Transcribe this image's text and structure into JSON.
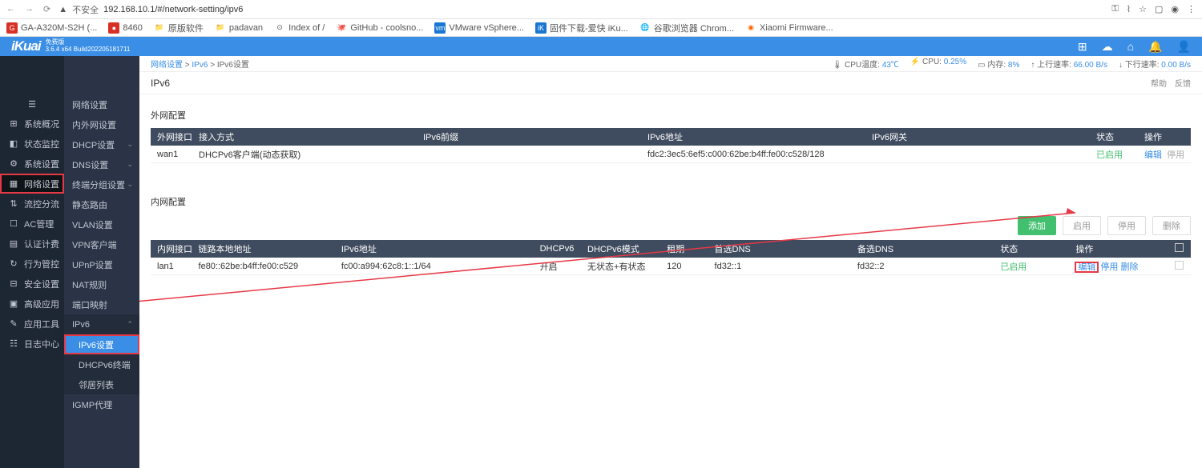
{
  "browser": {
    "url": "192.168.10.1/#/network-setting/ipv6",
    "insecure": "不安全",
    "bookmarks": [
      {
        "label": "GA-A320M-S2H (...",
        "color": "#d93025"
      },
      {
        "label": "8460",
        "color": "#d93025"
      },
      {
        "label": "原版软件",
        "color": "#5f6368"
      },
      {
        "label": "padavan",
        "color": "#5f6368"
      },
      {
        "label": "Index of /",
        "color": "#5f6368"
      },
      {
        "label": "GitHub - coolsno...",
        "color": "#333"
      },
      {
        "label": "VMware vSphere...",
        "color": "#1976d2"
      },
      {
        "label": "固件下载-爱快 iKu...",
        "color": "#1976d2"
      },
      {
        "label": "谷歌浏览器 Chrom...",
        "color": "#f4b400"
      },
      {
        "label": "Xiaomi Firmware...",
        "color": "#ff6700"
      }
    ]
  },
  "header": {
    "brand": "iKuai",
    "edition": "免费版",
    "version": "3.6.4 x64 Build202205181711"
  },
  "crumbs": {
    "a": "网络设置",
    "b": "IPv6",
    "c": "IPv6设置"
  },
  "status": {
    "cpu_temp_l": "CPU温度:",
    "cpu_temp_v": "43℃",
    "cpu_l": "CPU:",
    "cpu_v": "0.25%",
    "mem_l": "内存:",
    "mem_v": "8%",
    "up_l": "上行速率:",
    "up_v": "66.00 B/s",
    "down_l": "下行速率:",
    "down_v": "0.00 B/s"
  },
  "page": {
    "title": "IPv6",
    "help": "帮助",
    "feedback": "反馈"
  },
  "side1": [
    {
      "ico": "☰",
      "label": ""
    },
    {
      "ico": "⊞",
      "label": "系统概况"
    },
    {
      "ico": "◧",
      "label": "状态监控"
    },
    {
      "ico": "⚙",
      "label": "系统设置"
    },
    {
      "ico": "▦",
      "label": "网络设置"
    },
    {
      "ico": "⇅",
      "label": "流控分流"
    },
    {
      "ico": "☐",
      "label": "AC管理"
    },
    {
      "ico": "▤",
      "label": "认证计费"
    },
    {
      "ico": "↻",
      "label": "行为管控"
    },
    {
      "ico": "⊟",
      "label": "安全设置"
    },
    {
      "ico": "▣",
      "label": "高级应用"
    },
    {
      "ico": "✎",
      "label": "应用工具"
    },
    {
      "ico": "☷",
      "label": "日志中心"
    }
  ],
  "side2": [
    {
      "label": "网络设置",
      "chev": ""
    },
    {
      "label": "内外网设置",
      "chev": ""
    },
    {
      "label": "DHCP设置",
      "chev": "⌄"
    },
    {
      "label": "DNS设置",
      "chev": "⌄"
    },
    {
      "label": "终端分组设置",
      "chev": "⌄"
    },
    {
      "label": "静态路由",
      "chev": ""
    },
    {
      "label": "VLAN设置",
      "chev": ""
    },
    {
      "label": "VPN客户端",
      "chev": ""
    },
    {
      "label": "UPnP设置",
      "chev": ""
    },
    {
      "label": "NAT规则",
      "chev": ""
    },
    {
      "label": "端口映射",
      "chev": ""
    },
    {
      "label": "IPv6",
      "chev": "⌃"
    }
  ],
  "side2_sub": [
    {
      "label": "IPv6设置",
      "sel": true
    },
    {
      "label": "DHCPv6终端",
      "sel": false
    },
    {
      "label": "邻居列表",
      "sel": false
    }
  ],
  "side2_tail": {
    "label": "IGMP代理"
  },
  "wan": {
    "title": "外网配置",
    "head": {
      "c1": "外网接口",
      "c2": "接入方式",
      "c3": "IPv6前缀",
      "c4": "IPv6地址",
      "c5": "IPv6网关",
      "c6": "状态",
      "c7": "操作"
    },
    "row": {
      "iface": "wan1",
      "mode": "DHCPv6客户端(动态获取)",
      "prefix": "",
      "addr": "fdc2:3ec5:6ef5:c000:62be:b4ff:fe00:c528/128",
      "gw": "",
      "status": "已启用",
      "edit": "编辑",
      "stop": "停用"
    }
  },
  "lan": {
    "title": "内网配置",
    "actions": {
      "add": "添加",
      "enable": "启用",
      "disable": "停用",
      "delete": "删除"
    },
    "head": {
      "c1": "内网接口",
      "c2": "链路本地地址",
      "c3": "IPv6地址",
      "c4": "DHCPv6",
      "c5": "DHCPv6模式",
      "c6": "租期",
      "c7": "首选DNS",
      "c8": "备选DNS",
      "c9": "状态",
      "c10": "操作"
    },
    "row": {
      "iface": "lan1",
      "ll": "fe80::62be:b4ff:fe00:c529",
      "addr": "fc00:a994:62c8:1::1/64",
      "dhcp": "开启",
      "mode": "无状态+有状态",
      "lease": "120",
      "dns1": "fd32::1",
      "dns2": "fd32::2",
      "status": "已启用",
      "edit": "编辑",
      "disable": "停用",
      "delete": "删除"
    }
  }
}
